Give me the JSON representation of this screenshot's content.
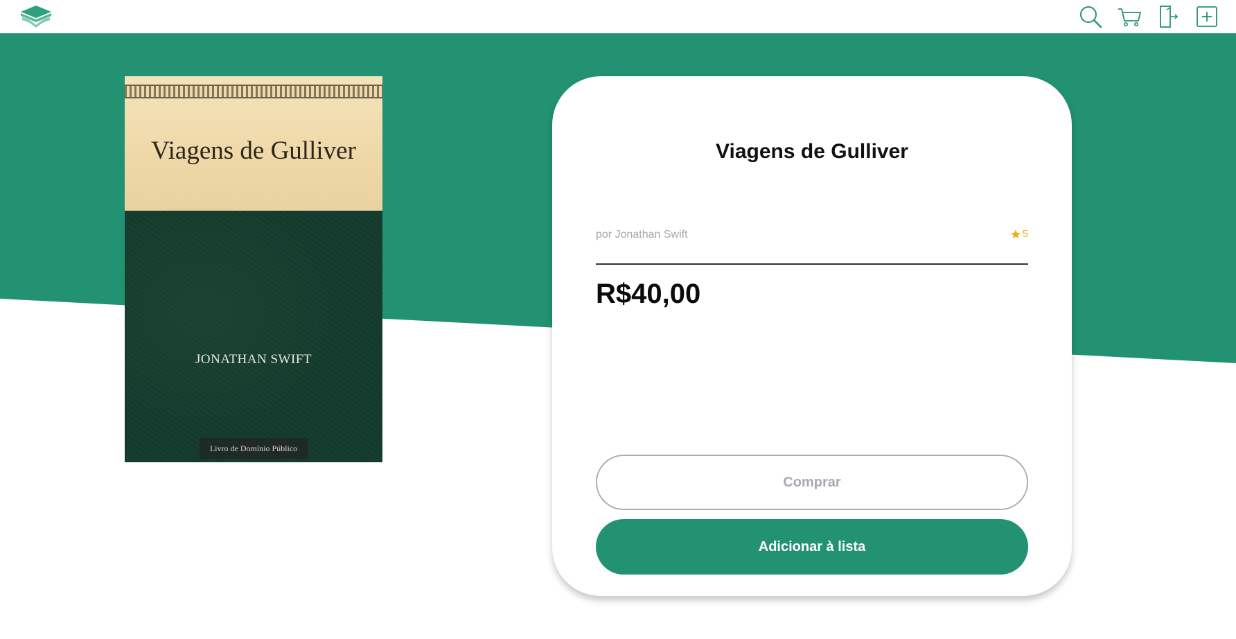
{
  "header": {
    "logo": "book-logo-icon",
    "icons": [
      "search-icon",
      "cart-icon",
      "logout-door-icon",
      "add-icon"
    ]
  },
  "colors": {
    "brand_green": "#229273",
    "star": "#e8b21a"
  },
  "cover": {
    "title": "Viagens de Gulliver",
    "author": "JONATHAN SWIFT",
    "badge": "Livro de Domínio Público"
  },
  "book": {
    "title": "Viagens de Gulliver",
    "author_line": "por Jonathan Swift",
    "rating": "5",
    "price": "R$40,00"
  },
  "actions": {
    "buy_label": "Comprar",
    "add_to_list_label": "Adicionar à lista"
  }
}
